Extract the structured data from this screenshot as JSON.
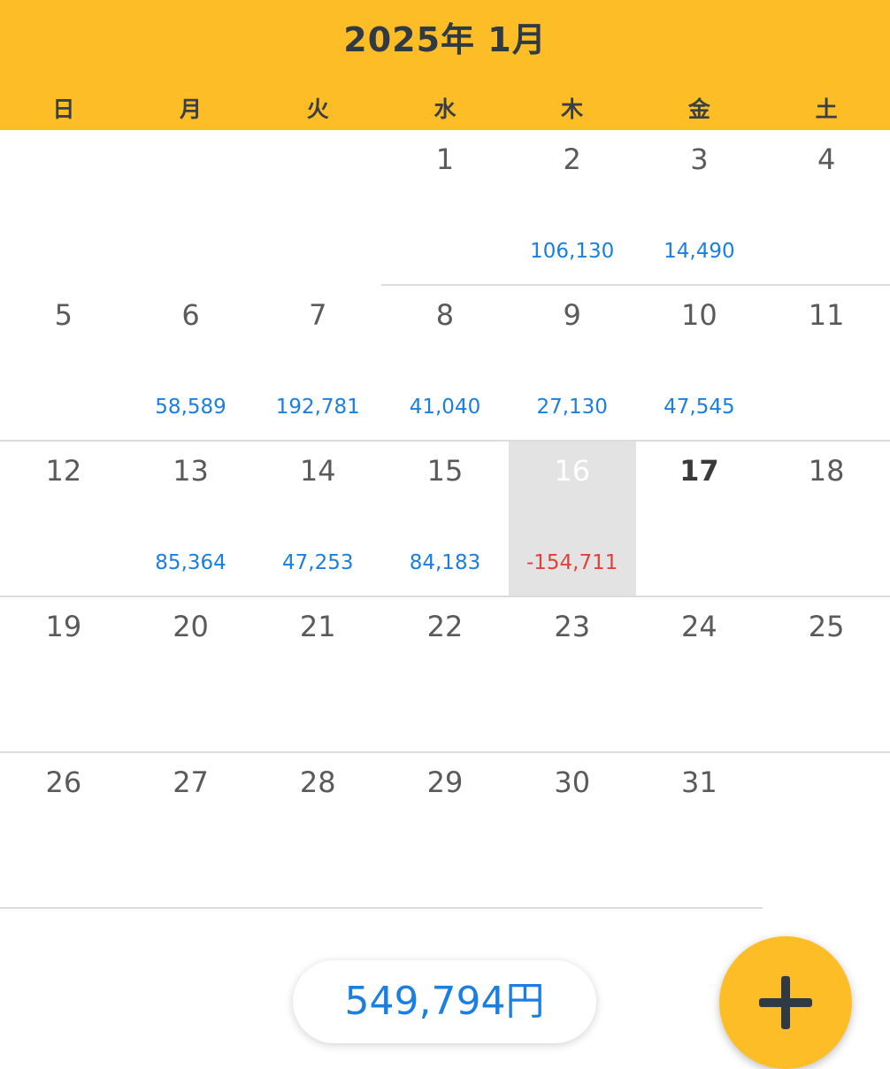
{
  "header": {
    "title": "2025年 1月",
    "weekdays": [
      "日",
      "月",
      "火",
      "水",
      "木",
      "金",
      "土"
    ]
  },
  "calendar": {
    "weeks": [
      [
        {
          "day": "",
          "amount": ""
        },
        {
          "day": "",
          "amount": ""
        },
        {
          "day": "",
          "amount": ""
        },
        {
          "day": "1",
          "amount": ""
        },
        {
          "day": "2",
          "amount": "106,130"
        },
        {
          "day": "3",
          "amount": "14,490"
        },
        {
          "day": "4",
          "amount": ""
        }
      ],
      [
        {
          "day": "5",
          "amount": ""
        },
        {
          "day": "6",
          "amount": "58,589"
        },
        {
          "day": "7",
          "amount": "192,781"
        },
        {
          "day": "8",
          "amount": "41,040"
        },
        {
          "day": "9",
          "amount": "27,130"
        },
        {
          "day": "10",
          "amount": "47,545"
        },
        {
          "day": "11",
          "amount": ""
        }
      ],
      [
        {
          "day": "12",
          "amount": ""
        },
        {
          "day": "13",
          "amount": "85,364"
        },
        {
          "day": "14",
          "amount": "47,253"
        },
        {
          "day": "15",
          "amount": "84,183"
        },
        {
          "day": "16",
          "amount": "-154,711",
          "negative": true,
          "selected": true
        },
        {
          "day": "17",
          "amount": "",
          "today": true
        },
        {
          "day": "18",
          "amount": ""
        }
      ],
      [
        {
          "day": "19",
          "amount": ""
        },
        {
          "day": "20",
          "amount": ""
        },
        {
          "day": "21",
          "amount": ""
        },
        {
          "day": "22",
          "amount": ""
        },
        {
          "day": "23",
          "amount": ""
        },
        {
          "day": "24",
          "amount": ""
        },
        {
          "day": "25",
          "amount": ""
        }
      ],
      [
        {
          "day": "26",
          "amount": ""
        },
        {
          "day": "27",
          "amount": ""
        },
        {
          "day": "28",
          "amount": ""
        },
        {
          "day": "29",
          "amount": ""
        },
        {
          "day": "30",
          "amount": ""
        },
        {
          "day": "31",
          "amount": ""
        },
        {
          "day": "",
          "amount": ""
        }
      ]
    ]
  },
  "footer": {
    "total": "549,794円",
    "add_icon": "plus-icon"
  },
  "colors": {
    "accent": "#FDBD26",
    "positive": "#1A7FE0",
    "negative": "#E0403A",
    "selected_bg": "#E3E3E3"
  }
}
